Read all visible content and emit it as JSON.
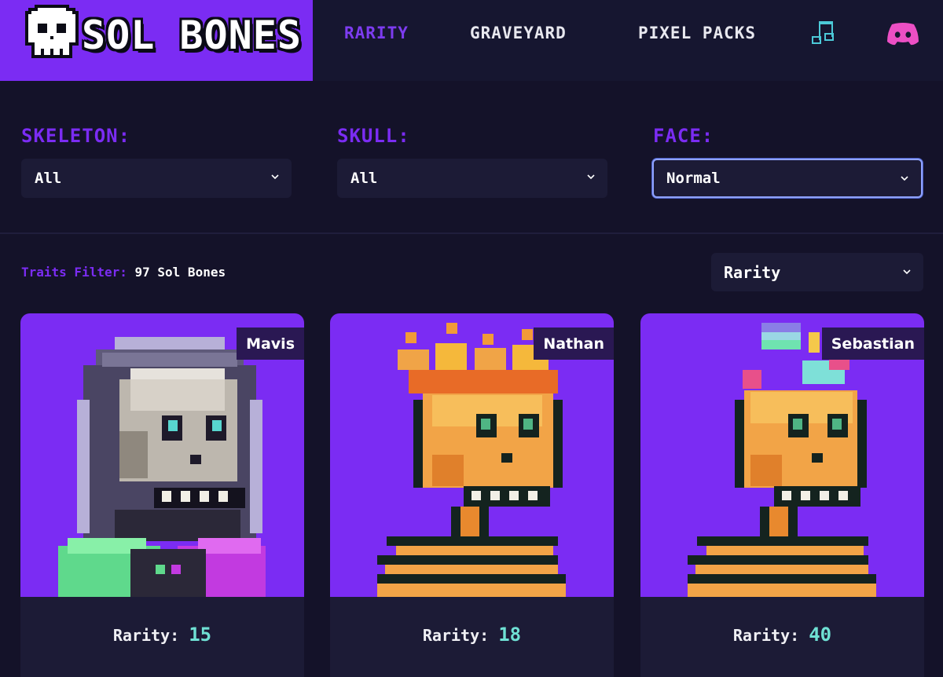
{
  "brand": {
    "name": "SOL BONES",
    "accent": "#7b2cf3"
  },
  "nav": {
    "items": [
      {
        "label": "RARITY",
        "active": true
      },
      {
        "label": "GRAVEYARD",
        "active": false
      },
      {
        "label": "PIXEL PACKS",
        "active": false
      }
    ],
    "icons": [
      "music-note-icon",
      "discord-icon"
    ]
  },
  "filters": {
    "skeleton": {
      "label": "SKELETON:",
      "value": "All"
    },
    "skull": {
      "label": "SKULL:",
      "value": "All"
    },
    "face": {
      "label": "FACE:",
      "value": "Normal"
    }
  },
  "results": {
    "label": "Traits Filter:",
    "count_text": "97 Sol Bones",
    "sort": {
      "value": "Rarity"
    }
  },
  "cards": [
    {
      "name": "Mavis",
      "rarity_label": "Rarity:",
      "rarity": "15"
    },
    {
      "name": "Nathan",
      "rarity_label": "Rarity:",
      "rarity": "18"
    },
    {
      "name": "Sebastian",
      "rarity_label": "Rarity:",
      "rarity": "40"
    }
  ]
}
